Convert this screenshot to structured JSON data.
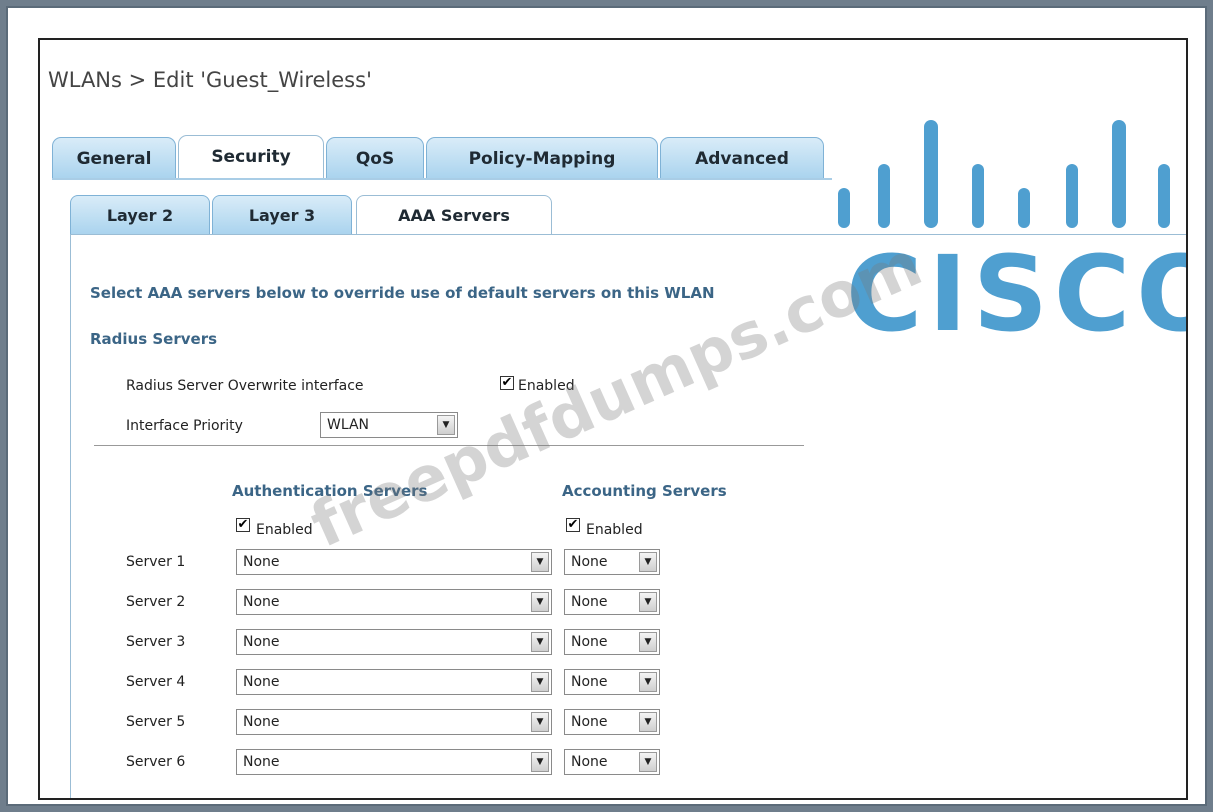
{
  "page": {
    "title": "WLANs > Edit  'Guest_Wireless'"
  },
  "tabs": [
    {
      "label": "General"
    },
    {
      "label": "Security"
    },
    {
      "label": "QoS"
    },
    {
      "label": "Policy-Mapping"
    },
    {
      "label": "Advanced"
    }
  ],
  "active_tab": "Security",
  "subtabs": [
    {
      "label": "Layer 2"
    },
    {
      "label": "Layer 3"
    },
    {
      "label": "AAA Servers"
    }
  ],
  "active_subtab": "AAA Servers",
  "intro": "Select AAA servers below to override use of default servers on this WLAN",
  "radius": {
    "heading": "Radius Servers",
    "overwrite_label": "Radius Server Overwrite interface",
    "overwrite_enabled_label": "Enabled",
    "overwrite_checked": true,
    "priority_label": "Interface Priority",
    "priority_value": "WLAN"
  },
  "servers": {
    "auth_heading": "Authentication Servers",
    "acct_heading": "Accounting Servers",
    "auth_enabled_label": "Enabled",
    "acct_enabled_label": "Enabled",
    "auth_checked": true,
    "acct_checked": true,
    "rows": [
      {
        "label": "Server 1",
        "auth": "None",
        "acct": "None"
      },
      {
        "label": "Server 2",
        "auth": "None",
        "acct": "None"
      },
      {
        "label": "Server 3",
        "auth": "None",
        "acct": "None"
      },
      {
        "label": "Server 4",
        "auth": "None",
        "acct": "None"
      },
      {
        "label": "Server 5",
        "auth": "None",
        "acct": "None"
      },
      {
        "label": "Server 6",
        "auth": "None",
        "acct": "None"
      }
    ]
  },
  "branding": {
    "logo_text": "CISCO",
    "logo_color": "#4f9fd0",
    "watermark": "freepdfdumps.com"
  },
  "colors": {
    "tab_blue": "#a9d3ee",
    "heading_blue": "#3b6586"
  }
}
